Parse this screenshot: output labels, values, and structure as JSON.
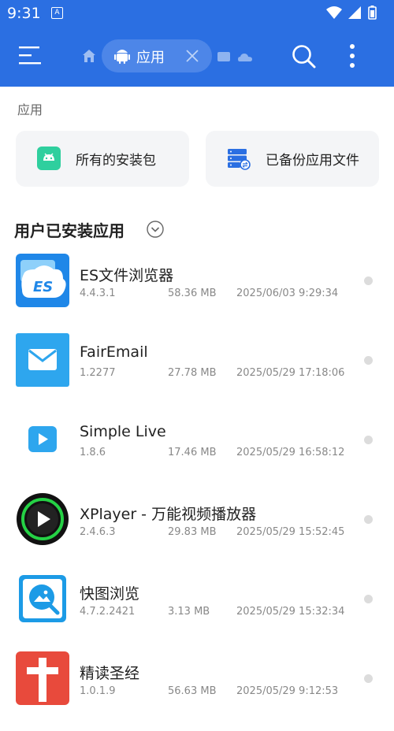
{
  "status": {
    "time": "9:31",
    "notification_glyph": "A"
  },
  "toolbar": {
    "chip_label": "应用"
  },
  "section": {
    "label": "应用"
  },
  "cards": [
    {
      "label": "所有的安装包",
      "icon": "android-package-icon"
    },
    {
      "label": "已备份应用文件",
      "icon": "backup-server-icon"
    }
  ],
  "list": {
    "title": "用户已安装应用",
    "apps": [
      {
        "name": "ES文件浏览器",
        "version": "4.4.3.1",
        "size": "58.36 MB",
        "date": "2025/06/03 9:29:34"
      },
      {
        "name": "FairEmail",
        "version": "1.2277",
        "size": "27.78 MB",
        "date": "2025/05/29 17:18:06"
      },
      {
        "name": "Simple Live",
        "version": "1.8.6",
        "size": "17.46 MB",
        "date": "2025/05/29 16:58:12"
      },
      {
        "name": "XPlayer - 万能视频播放器",
        "version": "2.4.6.3",
        "size": "29.83 MB",
        "date": "2025/05/29 15:52:45"
      },
      {
        "name": "快图浏览",
        "version": "4.7.2.2421",
        "size": "3.13 MB",
        "date": "2025/05/29 15:32:34"
      },
      {
        "name": "精读圣经",
        "version": "1.0.1.9",
        "size": "56.63 MB",
        "date": "2025/05/29 9:12:53"
      }
    ]
  },
  "colors": {
    "primary": "#2b6fe2",
    "chip": "#4d86e8",
    "card_bg": "#f4f5f7"
  }
}
